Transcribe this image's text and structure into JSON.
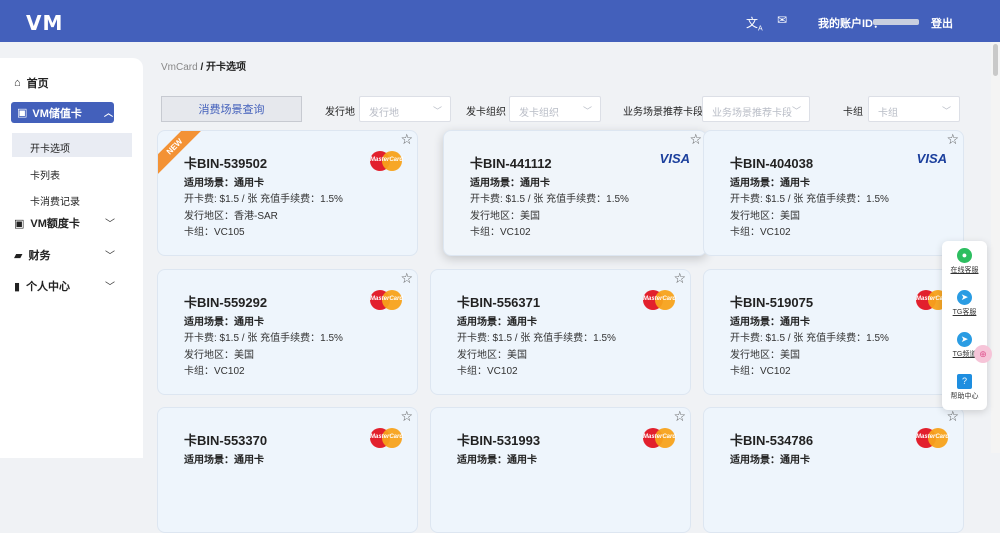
{
  "header": {
    "logo": "VM",
    "translate_icon": "translate-icon",
    "mail_icon": "mail-icon",
    "account_label": "我的账户ID：",
    "logout": "登出"
  },
  "sidebar": {
    "home": "首页",
    "vm_stored_card": "VM储值卡",
    "sub_open_card": "开卡选项",
    "sub_card_list": "卡列表",
    "sub_consume_records": "卡消费记录",
    "vm_credit_card": "VM额度卡",
    "finance": "财务",
    "personal_center": "个人中心"
  },
  "breadcrumb": {
    "parent": "VmCard",
    "separator": " / ",
    "current": "开卡选项"
  },
  "filters": {
    "query_button": "消费场景查询",
    "issuer_label": "发行地",
    "issuer_placeholder": "发行地",
    "org_label": "发卡组织",
    "org_placeholder": "发卡组织",
    "segment_label": "业务场景推荐卡段",
    "segment_placeholder": "业务场景推荐卡段",
    "group_label": "卡组",
    "group_placeholder": "卡组"
  },
  "cards": [
    {
      "bin": "卡BIN-539502",
      "scene": "适用场景：通用卡",
      "fee": "开卡费:  $1.5 / 张    充值手续费：1.5%",
      "region": "发行地区：香港-SAR",
      "group": "卡组：VC105",
      "brand": "mastercard",
      "new": true,
      "new_label": "NEW"
    },
    {
      "bin": "卡BIN-441112",
      "scene": "适用场景：通用卡",
      "fee": "开卡费:  $1.5 / 张    充值手续费：1.5%",
      "region": "发行地区：美国",
      "group": "卡组：VC102",
      "brand": "visa"
    },
    {
      "bin": "卡BIN-404038",
      "scene": "适用场景：通用卡",
      "fee": "开卡费:  $1.5 / 张    充值手续费：1.5%",
      "region": "发行地区：美国",
      "group": "卡组：VC102",
      "brand": "visa"
    },
    {
      "bin": "卡BIN-559292",
      "scene": "适用场景：通用卡",
      "fee": "开卡费:  $1.5 / 张    充值手续费：1.5%",
      "region": "发行地区：美国",
      "group": "卡组：VC102",
      "brand": "mastercard"
    },
    {
      "bin": "卡BIN-556371",
      "scene": "适用场景：通用卡",
      "fee": "开卡费:  $1.5 / 张    充值手续费：1.5%",
      "region": "发行地区：美国",
      "group": "卡组：VC102",
      "brand": "mastercard"
    },
    {
      "bin": "卡BIN-519075",
      "scene": "适用场景：通用卡",
      "fee": "开卡费:  $1.5 / 张    充值手续费：1.5%",
      "region": "发行地区：美国",
      "group": "卡组：VC102",
      "brand": "mastercard"
    },
    {
      "bin": "卡BIN-553370",
      "scene": "适用场景：通用卡",
      "brand": "mastercard"
    },
    {
      "bin": "卡BIN-531993",
      "scene": "适用场景：通用卡",
      "brand": "mastercard"
    },
    {
      "bin": "卡BIN-534786",
      "scene": "适用场景：通用卡",
      "brand": "mastercard"
    }
  ],
  "brand_text": {
    "mastercard": "MasterCard",
    "visa": "VISA"
  },
  "float_menu": {
    "online_service": "在线客服",
    "tg_service": "TG客服",
    "tg_group": "TG频道",
    "help_center": "帮助中心"
  }
}
